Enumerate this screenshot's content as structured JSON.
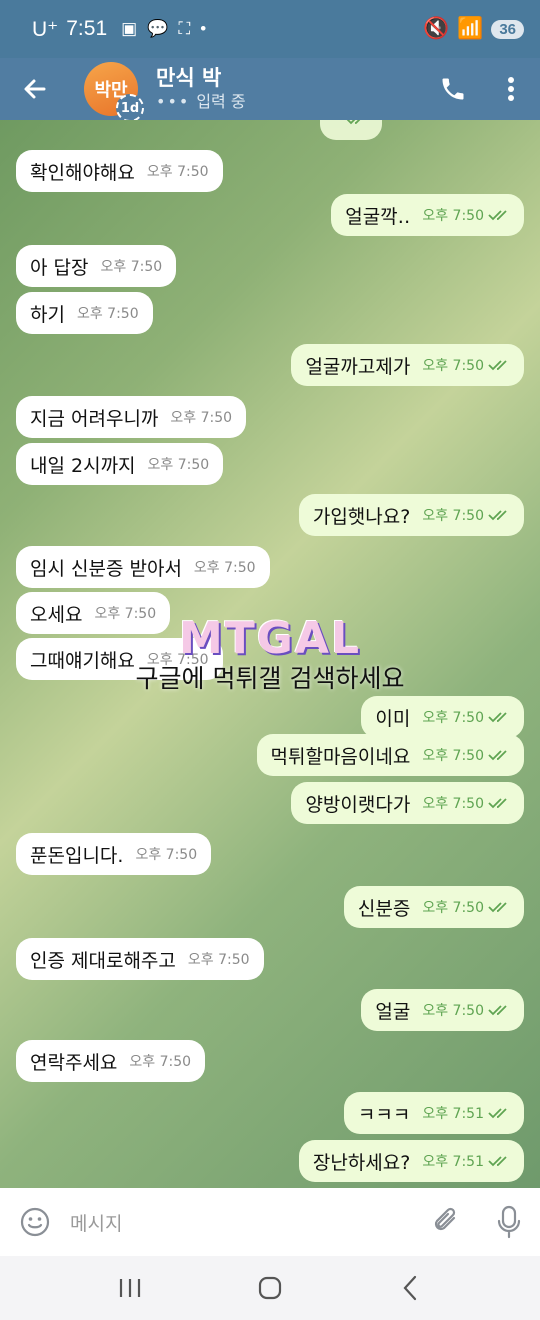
{
  "status_bar": {
    "carrier": "U⁺",
    "time": "7:51",
    "battery": "36"
  },
  "header": {
    "avatar_text": "박만",
    "avatar_badge": "1d",
    "name": "만식 박",
    "status": "입력 중",
    "status_dots": "•••"
  },
  "messages": [
    {
      "dir": "in",
      "text": "확인해야해요",
      "time": "오후 7:50"
    },
    {
      "dir": "out",
      "text": "얼굴깍‥",
      "time": "오후 7:50"
    },
    {
      "dir": "in",
      "text": "아 답장",
      "time": "오후 7:50"
    },
    {
      "dir": "in",
      "text": "하기",
      "time": "오후 7:50"
    },
    {
      "dir": "out",
      "text": "얼굴까고제가",
      "time": "오후 7:50"
    },
    {
      "dir": "in",
      "text": "지금 어려우니까",
      "time": "오후 7:50"
    },
    {
      "dir": "in",
      "text": "내일 2시까지",
      "time": "오후 7:50"
    },
    {
      "dir": "out",
      "text": "가입햇나요?",
      "time": "오후 7:50"
    },
    {
      "dir": "in",
      "text": "임시 신분증 받아서",
      "time": "오후 7:50"
    },
    {
      "dir": "in",
      "text": "오세요",
      "time": "오후 7:50"
    },
    {
      "dir": "in",
      "text": "그때얘기해요",
      "time": "오후 7:50"
    },
    {
      "dir": "out",
      "text": "이미",
      "time": "오후 7:50"
    },
    {
      "dir": "out",
      "text": "먹튀할마음이네요",
      "time": "오후 7:50"
    },
    {
      "dir": "out",
      "text": "양방이랫다가",
      "time": "오후 7:50"
    },
    {
      "dir": "in",
      "text": "푼돈입니다.",
      "time": "오후 7:50"
    },
    {
      "dir": "out",
      "text": "신분증",
      "time": "오후 7:50"
    },
    {
      "dir": "in",
      "text": "인증 제대로해주고",
      "time": "오후 7:50"
    },
    {
      "dir": "out",
      "text": "얼굴",
      "time": "오후 7:50"
    },
    {
      "dir": "in",
      "text": "연락주세요",
      "time": "오후 7:50"
    },
    {
      "dir": "out",
      "text": "ㅋㅋㅋ",
      "time": "오후 7:51"
    },
    {
      "dir": "out",
      "text": "장난하세요?",
      "time": "오후 7:51"
    }
  ],
  "watermark": {
    "logo": "MTGAL",
    "text": "구글에 먹튀갤 검색하세요"
  },
  "composer": {
    "placeholder": "메시지"
  },
  "colors": {
    "header": "#517da2",
    "incoming_bubble": "#ffffff",
    "outgoing_bubble": "#eefbd8",
    "read_check": "#5fa452"
  },
  "icons": {
    "back": "arrow-left-icon",
    "call": "phone-icon",
    "more": "more-vertical-icon",
    "emoji": "emoji-icon",
    "attach": "paperclip-icon",
    "mic": "microphone-icon"
  }
}
